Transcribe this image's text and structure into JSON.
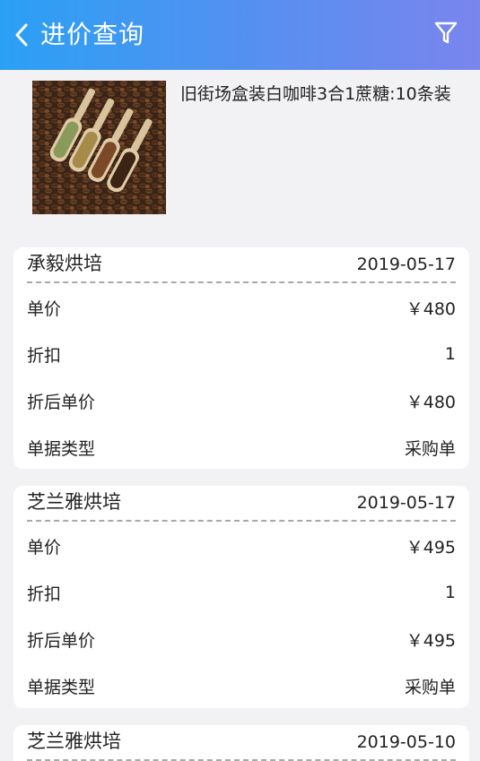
{
  "header": {
    "title": "进价查询",
    "back_icon": "chevron-left-icon",
    "filter_icon": "filter-icon"
  },
  "product": {
    "name": "旧街场盒装白咖啡3合1蔗糖:10条装",
    "image": "coffee-beans-scoops-image"
  },
  "records": [
    {
      "supplier": "承毅烘培",
      "date": "2019-05-17",
      "fields": [
        {
          "label": "单价",
          "value": "￥480"
        },
        {
          "label": "折扣",
          "value": "1"
        },
        {
          "label": "折后单价",
          "value": "￥480"
        },
        {
          "label": "单据类型",
          "value": "采购单"
        }
      ]
    },
    {
      "supplier": "芝兰雅烘培",
      "date": "2019-05-17",
      "fields": [
        {
          "label": "单价",
          "value": "￥495"
        },
        {
          "label": "折扣",
          "value": "1"
        },
        {
          "label": "折后单价",
          "value": "￥495"
        },
        {
          "label": "单据类型",
          "value": "采购单"
        }
      ]
    },
    {
      "supplier": "芝兰雅烘培",
      "date": "2019-05-10",
      "fields": []
    }
  ]
}
